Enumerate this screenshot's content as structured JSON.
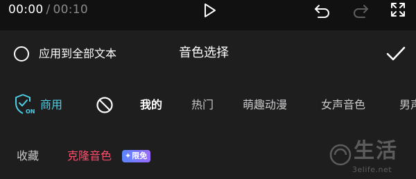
{
  "player": {
    "current_time": "00:00",
    "separator": "/",
    "total_time": "00:10",
    "icons": {
      "play": "play-icon",
      "undo": "undo-icon",
      "redo": "redo-icon",
      "fullscreen": "fullscreen-icon"
    }
  },
  "header": {
    "apply_all_label": "应用到全部文本",
    "title": "音色选择",
    "confirm_icon": "checkmark-icon"
  },
  "tabs": {
    "commercial_label": "商用",
    "items": [
      "我的",
      "热门",
      "萌趣动漫",
      "女声音色",
      "男声"
    ],
    "selected": "我的",
    "colors": {
      "commercial": "#4fd0e6",
      "selected": "#ffffff",
      "normal": "#c9c9cb"
    }
  },
  "subrow": {
    "favorites_label": "收藏",
    "clone_label": "克隆音色",
    "badge_label": "限免",
    "colors": {
      "clone": "#ff4f6d",
      "badge_start": "#5a86ff",
      "badge_end": "#9b6cff"
    }
  },
  "watermark": {
    "text": "生活",
    "url": "3elife.net"
  }
}
